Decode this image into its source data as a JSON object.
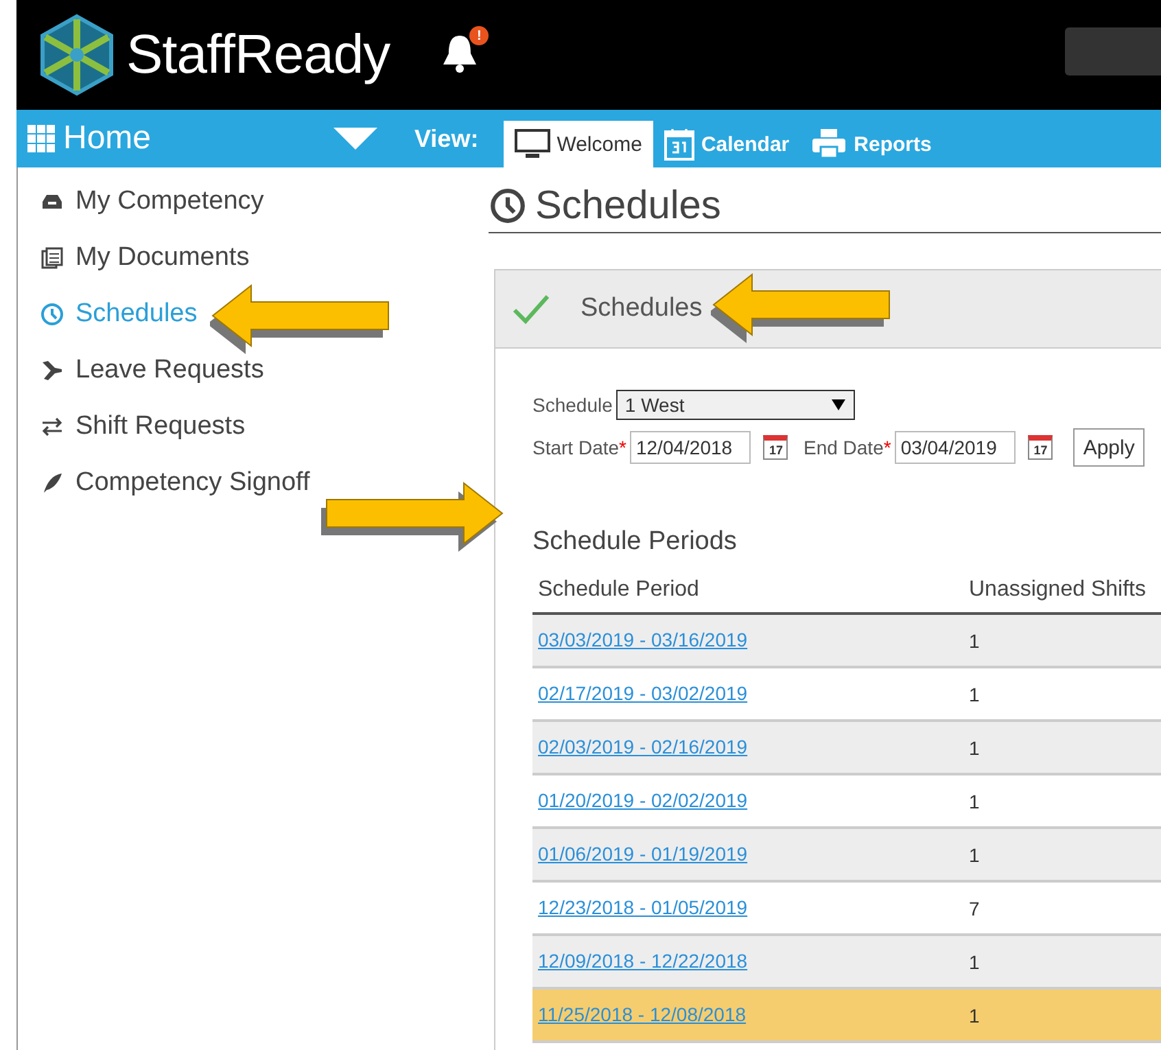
{
  "header": {
    "brand": "StaffReady",
    "notification_badge": "!"
  },
  "nav_bar": {
    "home": "Home",
    "view_label": "View:",
    "tabs": [
      {
        "label": "Welcome",
        "kind": "monitor",
        "selected": true
      },
      {
        "label": "Calendar",
        "kind": "calendar",
        "selected": false
      },
      {
        "label": "Reports",
        "kind": "printer",
        "selected": false
      }
    ]
  },
  "sidebar": {
    "items": [
      {
        "label": "My Competency",
        "kind": "inbox",
        "selected": false
      },
      {
        "label": "My Documents",
        "kind": "documents",
        "selected": false
      },
      {
        "label": "Schedules",
        "kind": "clock",
        "selected": true
      },
      {
        "label": "Leave Requests",
        "kind": "plane",
        "selected": false
      },
      {
        "label": "Shift Requests",
        "kind": "swap",
        "selected": false
      },
      {
        "label": "Competency Signoff",
        "kind": "feather",
        "selected": false
      }
    ]
  },
  "page": {
    "title": "Schedules"
  },
  "panel": {
    "title": "Schedules",
    "form": {
      "schedule_label": "Schedule",
      "schedule_value": "1 West",
      "start_label": "Start Date",
      "start_value": "12/04/2018",
      "end_label": "End Date",
      "end_value": "03/04/2019",
      "required_mark": "*",
      "start_calendar_day": "17",
      "end_calendar_day": "17",
      "apply": "Apply"
    },
    "periods_title": "Schedule Periods",
    "table": {
      "columns": [
        "Schedule Period",
        "Unassigned Shifts"
      ],
      "rows": [
        {
          "period": "03/03/2019 - 03/16/2019",
          "unassigned": "1",
          "selected": false
        },
        {
          "period": "02/17/2019 - 03/02/2019",
          "unassigned": "1",
          "selected": false
        },
        {
          "period": "02/03/2019 - 02/16/2019",
          "unassigned": "1",
          "selected": false
        },
        {
          "period": "01/20/2019 - 02/02/2019",
          "unassigned": "1",
          "selected": false
        },
        {
          "period": "01/06/2019 - 01/19/2019",
          "unassigned": "1",
          "selected": false
        },
        {
          "period": "12/23/2018 - 01/05/2019",
          "unassigned": "7",
          "selected": false
        },
        {
          "period": "12/09/2018 - 12/22/2018",
          "unassigned": "1",
          "selected": false
        },
        {
          "period": "11/25/2018 - 12/08/2018",
          "unassigned": "1",
          "selected": true
        }
      ]
    }
  },
  "callouts": [
    {
      "kind": "left"
    },
    {
      "kind": "left"
    },
    {
      "kind": "right"
    }
  ]
}
